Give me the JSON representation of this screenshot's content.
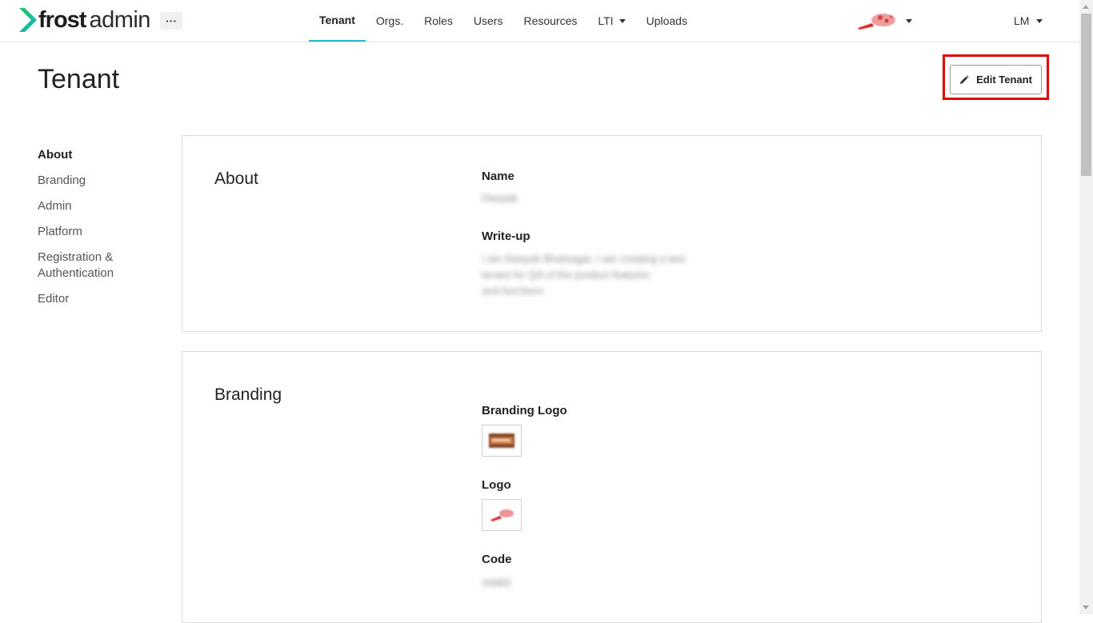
{
  "brand": {
    "name_bold": "frost",
    "name_light": "admin",
    "more_label": "···"
  },
  "nav": {
    "tabs": [
      {
        "label": "Tenant",
        "active": true
      },
      {
        "label": "Orgs."
      },
      {
        "label": "Roles"
      },
      {
        "label": "Users"
      },
      {
        "label": "Resources"
      },
      {
        "label": "LTI"
      },
      {
        "label": "Uploads"
      }
    ]
  },
  "user": {
    "initials": "LM"
  },
  "page": {
    "title": "Tenant",
    "edit_button": "Edit Tenant"
  },
  "sidenav": {
    "items": [
      {
        "label": "About",
        "active": true
      },
      {
        "label": "Branding"
      },
      {
        "label": "Admin"
      },
      {
        "label": "Platform"
      },
      {
        "label": "Registration & Authentication"
      },
      {
        "label": "Editor"
      }
    ]
  },
  "about": {
    "title": "About",
    "name_label": "Name",
    "name_value": "Deepak",
    "writeup_label": "Write-up",
    "writeup_lines": [
      "I am Deepak Bhatnagar. I am creating a test",
      "tenant for QA of the product features",
      "and functions"
    ]
  },
  "branding": {
    "title": "Branding",
    "branding_logo_label": "Branding Logo",
    "logo_label": "Logo",
    "code_label": "Code",
    "code_value": "34983"
  },
  "colors": {
    "accent": "#27b8c9",
    "brand_green": "#1fbf6a",
    "highlight": "#e00000"
  },
  "icons": {
    "edit": "pencil-icon",
    "more": "ellipsis-icon",
    "dropdown": "chevron-down-icon"
  }
}
